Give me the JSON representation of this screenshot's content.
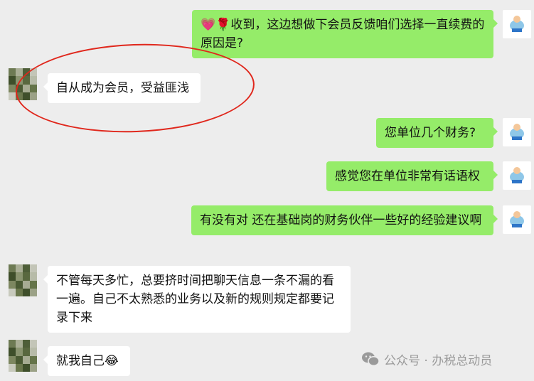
{
  "messages": [
    {
      "side": "right",
      "text": "收到，这边想做下会员反馈咱们选择一直续费的原因是?",
      "emoji_prefix": "💗🌹"
    },
    {
      "side": "left",
      "text": "自从成为会员，受益匪浅"
    },
    {
      "side": "right",
      "text": "您单位几个财务?"
    },
    {
      "side": "right",
      "text": "感觉您在单位非常有话语权"
    },
    {
      "side": "right",
      "text": "有没有对  还在基础岗的财务伙伴一些好的经验建议啊"
    },
    {
      "side": "left",
      "text": "不管每天多忙，总要挤时间把聊天信息一条不漏的看一遍。自己不太熟悉的业务以及新的规则规定都要记录下来"
    },
    {
      "side": "left",
      "text": "就我自己",
      "emoji_suffix": "😂"
    }
  ],
  "watermark": {
    "text": "公众号 · 办税总动员",
    "icon": "wechat-icon"
  },
  "annotation": {
    "shape": "red-ellipse",
    "color": "#e0271c"
  }
}
